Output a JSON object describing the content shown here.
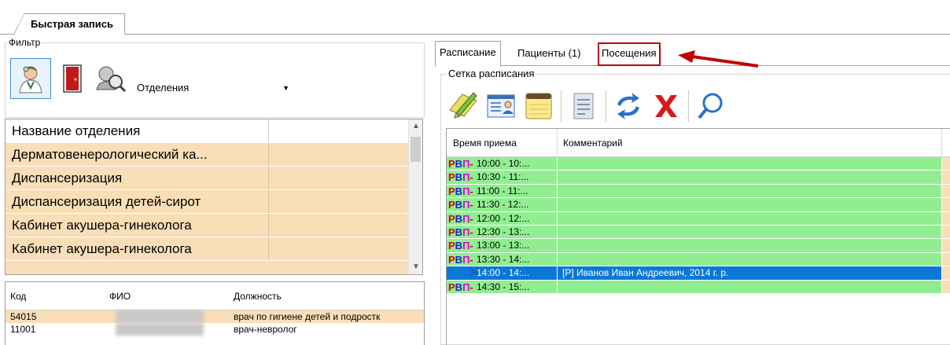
{
  "main_tab": {
    "label": "Быстрая запись"
  },
  "filter": {
    "legend": "Фильтр",
    "select_value": "Отделения",
    "tools": [
      {
        "icon": "doctor-icon"
      },
      {
        "icon": "door-icon"
      },
      {
        "icon": "search-person-icon"
      }
    ]
  },
  "dept_list": {
    "header": "Название отделения",
    "items": [
      "Дерматовенерологический ка...",
      "Диспансеризация",
      "Диспансеризация детей-сирот",
      "Кабинет акушера-гинеколога",
      "Кабинет акушера-гинеколога"
    ]
  },
  "staff": {
    "headers": {
      "code": "Код",
      "fio": "ФИО",
      "position": "Должность"
    },
    "rows": [
      {
        "code": "54015",
        "position": "врач по гигиене детей и подростк"
      },
      {
        "code": "11001",
        "position": "врач-невролог"
      }
    ]
  },
  "right_tabs": {
    "schedule": "Расписание",
    "patients": "Пациенты (1)",
    "visits": "Посещения"
  },
  "schedule": {
    "legend": "Сетка расписания",
    "col_time": "Время приема",
    "col_comment": "Комментарий",
    "flag": {
      "r": "Р",
      "v": "В",
      "p": "П",
      "dash": "-"
    },
    "rows": [
      {
        "time": "10:00 - 10:..."
      },
      {
        "time": "10:30 - 11:..."
      },
      {
        "time": "11:00 - 11:..."
      },
      {
        "time": "11:30 - 12:..."
      },
      {
        "time": "12:00 - 12:..."
      },
      {
        "time": "12:30 - 13:..."
      },
      {
        "time": "13:00 - 13:..."
      },
      {
        "time": "13:30 - 14:..."
      },
      {
        "time": "14:00 - 14:...",
        "comment": "[Р] Иванов Иван Андреевич, 2014 г. р.",
        "selected": true
      },
      {
        "time": "14:30 - 15:..."
      }
    ]
  },
  "colors": {
    "free_slot": "#90ee90",
    "selected_row": "#0a78d7",
    "dept_row": "#f9deb8",
    "annotation": "#c00000"
  }
}
